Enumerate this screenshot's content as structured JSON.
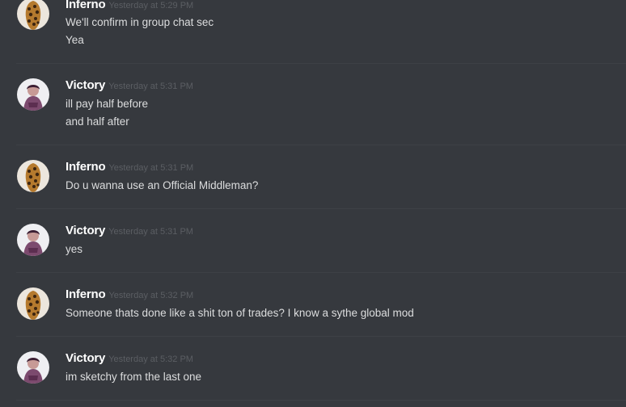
{
  "messages": [
    {
      "author": "Inferno",
      "avatar": "leopard-avatar-icon",
      "timestamp": "Yesterday at 5:29 PM",
      "lines": [
        "We'll confirm in group chat sec",
        "Yea"
      ]
    },
    {
      "author": "Victory",
      "avatar": "victory-avatar-icon",
      "timestamp": "Yesterday at 5:31 PM",
      "lines": [
        "ill pay half before",
        "and half after"
      ]
    },
    {
      "author": "Inferno",
      "avatar": "leopard-avatar-icon",
      "timestamp": "Yesterday at 5:31 PM",
      "lines": [
        "Do u wanna use an Official Middleman?"
      ]
    },
    {
      "author": "Victory",
      "avatar": "victory-avatar-icon",
      "timestamp": "Yesterday at 5:31 PM",
      "lines": [
        "yes"
      ]
    },
    {
      "author": "Inferno",
      "avatar": "leopard-avatar-icon",
      "timestamp": "Yesterday at 5:32 PM",
      "lines": [
        "Someone thats done like a shit ton of trades? I know a sythe global mod"
      ]
    },
    {
      "author": "Victory",
      "avatar": "victory-avatar-icon",
      "timestamp": "Yesterday at 5:32 PM",
      "lines": [
        "im sketchy from the last one"
      ]
    }
  ],
  "colors": {
    "background": "#36393e",
    "divider": "#3e4146",
    "username": "#ffffff",
    "timestamp": "#5b5e63",
    "message_text": "#dcddde"
  }
}
